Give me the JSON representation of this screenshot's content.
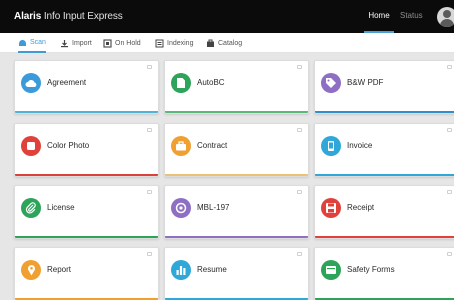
{
  "app": {
    "brand_bold": "Alaris",
    "brand_rest": " Info Input Express",
    "nav_home": "Home",
    "nav_status": "Status",
    "user_icon": "user-avatar-icon"
  },
  "tabs": [
    {
      "label": "Scan",
      "icon": "scanner-icon",
      "active": true
    },
    {
      "label": "Import",
      "icon": "import-icon",
      "active": false
    },
    {
      "label": "On Hold",
      "icon": "on-hold-icon",
      "active": false
    },
    {
      "label": "Indexing",
      "icon": "indexing-icon",
      "active": false
    },
    {
      "label": "Catalog",
      "icon": "catalog-icon",
      "active": false
    }
  ],
  "tiles": [
    {
      "label": "Agreement",
      "icon": "cloud-icon",
      "color": "#3b9ad9",
      "accent": "#4fb3d9"
    },
    {
      "label": "AutoBC",
      "icon": "document-icon",
      "color": "#2ea35a",
      "accent": "#5cb87a"
    },
    {
      "label": "B&W PDF",
      "icon": "tag-icon",
      "color": "#8e6fc4",
      "accent": "#2e8fca"
    },
    {
      "label": "Color Photo",
      "icon": "square-icon",
      "color": "#e0413a",
      "accent": "#d9413a"
    },
    {
      "label": "Contract",
      "icon": "briefcase-icon",
      "color": "#f0a030",
      "accent": "#e9c275"
    },
    {
      "label": "Invoice",
      "icon": "phone-icon",
      "color": "#2fa7d8",
      "accent": "#2fa7d8"
    },
    {
      "label": "License",
      "icon": "paperclip-icon",
      "color": "#2ea35a",
      "accent": "#2ea35a"
    },
    {
      "label": "MBL-197",
      "icon": "target-icon",
      "color": "#8e6fc4",
      "accent": "#8e6fc4"
    },
    {
      "label": "Receipt",
      "icon": "save-icon",
      "color": "#e0413a",
      "accent": "#e0413a"
    },
    {
      "label": "Report",
      "icon": "location-pin-icon",
      "color": "#f0a030",
      "accent": "#f0a030"
    },
    {
      "label": "Resume",
      "icon": "bar-chart-icon",
      "color": "#2fa7d8",
      "accent": "#2fa7d8"
    },
    {
      "label": "Safety Forms",
      "icon": "window-icon",
      "color": "#2ea35a",
      "accent": "#2ea35a"
    }
  ]
}
